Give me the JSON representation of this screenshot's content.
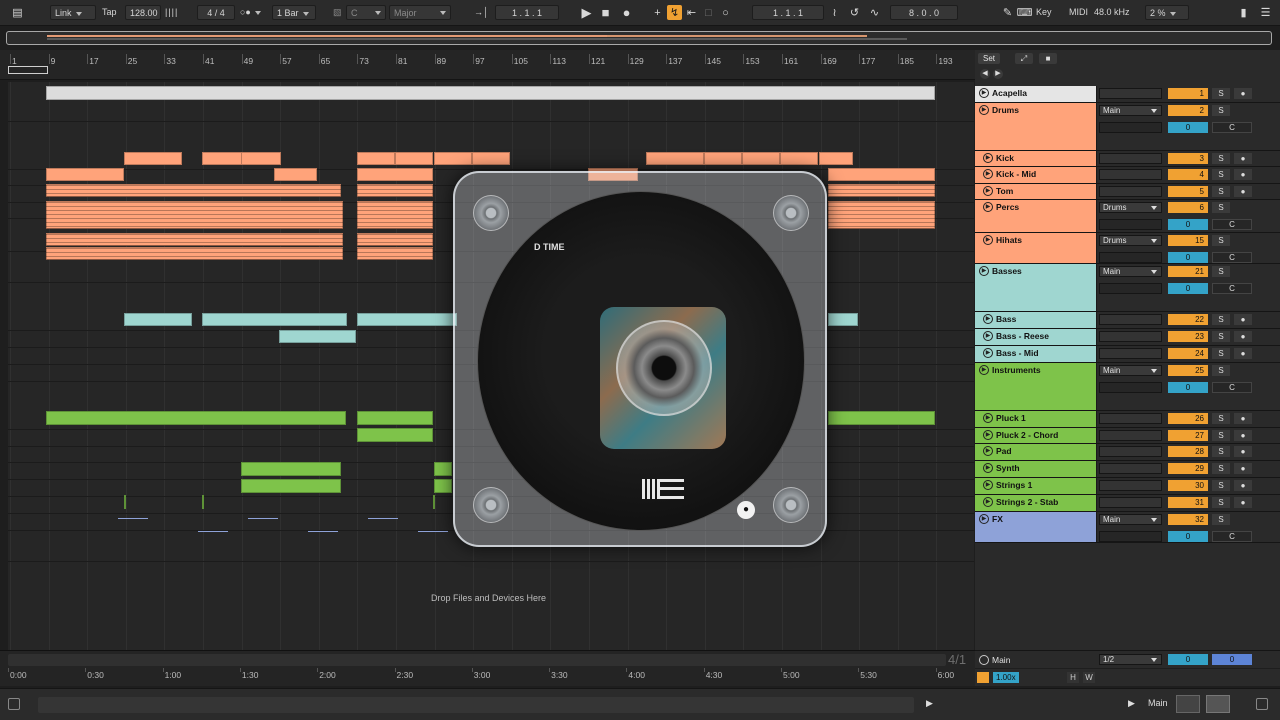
{
  "topbar": {
    "link": "Link",
    "tap": "Tap",
    "tempo": "128.00",
    "time_sig": "4 / 4",
    "quantize": "1 Bar",
    "key_root": "C",
    "scale": "Major",
    "arrangement_position": "1 . 1 . 1",
    "loop_start": "1 . 1 . 1",
    "loop_length": "8 . 0 . 0",
    "key_map": "Key",
    "midi_map": "MIDI",
    "sample_rate": "48.0 kHz",
    "cpu": "2 %"
  },
  "ruler": {
    "bars": [
      "1",
      "9",
      "17",
      "25",
      "33",
      "41",
      "49",
      "57",
      "65",
      "73",
      "81",
      "89",
      "97",
      "105",
      "113",
      "121",
      "129",
      "137",
      "145",
      "153",
      "161",
      "169",
      "177",
      "185",
      "193"
    ]
  },
  "arrangement": {
    "drop_hint": "Drop Files and Devices Here",
    "zoom_fraction": "4/1"
  },
  "timeline": {
    "labels": [
      "0:00",
      "0:30",
      "1:00",
      "1:30",
      "2:00",
      "2:30",
      "3:00",
      "3:30",
      "4:00",
      "4:30",
      "5:00",
      "5:30",
      "6:00"
    ]
  },
  "track_header": {
    "set_label": "Set"
  },
  "tracks": [
    {
      "name": "Acapella",
      "color": "#e5e5e5",
      "group": false,
      "sub": false,
      "route": "",
      "number": "1",
      "solo": "S",
      "rec_icon": "record-icon"
    },
    {
      "name": "Drums",
      "color": "#ffa37a",
      "group": true,
      "sub": false,
      "route": "Main",
      "number": "2",
      "solo": "S",
      "pan": "0",
      "cue": "C"
    },
    {
      "name": "Kick",
      "color": "#ffa37a",
      "group": false,
      "sub": true,
      "route": "",
      "number": "3",
      "solo": "S"
    },
    {
      "name": "Kick - Mid",
      "color": "#ffa37a",
      "group": false,
      "sub": true,
      "route": "",
      "number": "4",
      "solo": "S"
    },
    {
      "name": "Tom",
      "color": "#ffa37a",
      "group": false,
      "sub": true,
      "route": "",
      "number": "5",
      "solo": "S"
    },
    {
      "name": "Percs",
      "color": "#ffa37a",
      "group": true,
      "sub": true,
      "route": "Drums",
      "number": "6",
      "solo": "S",
      "pan": "0",
      "cue": "C"
    },
    {
      "name": "Hihats",
      "color": "#ffa37a",
      "group": true,
      "sub": true,
      "route": "Drums",
      "number": "15",
      "solo": "S",
      "pan": "0",
      "cue": "C"
    },
    {
      "name": "Basses",
      "color": "#9fd6d0",
      "group": true,
      "sub": false,
      "route": "Main",
      "number": "21",
      "solo": "S",
      "pan": "0",
      "cue": "C"
    },
    {
      "name": "Bass",
      "color": "#9fd6d0",
      "group": false,
      "sub": true,
      "route": "",
      "number": "22",
      "solo": "S"
    },
    {
      "name": "Bass - Reese",
      "color": "#9fd6d0",
      "group": false,
      "sub": true,
      "route": "",
      "number": "23",
      "solo": "S"
    },
    {
      "name": "Bass - Mid",
      "color": "#9fd6d0",
      "group": false,
      "sub": true,
      "route": "",
      "number": "24",
      "solo": "S"
    },
    {
      "name": "Instruments",
      "color": "#7ec34a",
      "group": true,
      "sub": false,
      "route": "Main",
      "number": "25",
      "solo": "S",
      "pan": "0",
      "cue": "C"
    },
    {
      "name": "Pluck 1",
      "color": "#7ec34a",
      "group": false,
      "sub": true,
      "route": "",
      "number": "26",
      "solo": "S"
    },
    {
      "name": "Pluck 2 - Chord",
      "color": "#7ec34a",
      "group": false,
      "sub": true,
      "route": "",
      "number": "27",
      "solo": "S"
    },
    {
      "name": "Pad",
      "color": "#7ec34a",
      "group": false,
      "sub": true,
      "route": "",
      "number": "28",
      "solo": "S"
    },
    {
      "name": "Synth",
      "color": "#7ec34a",
      "group": false,
      "sub": true,
      "route": "",
      "number": "29",
      "solo": "S"
    },
    {
      "name": "Strings 1",
      "color": "#7ec34a",
      "group": false,
      "sub": true,
      "route": "",
      "number": "30",
      "solo": "S"
    },
    {
      "name": "Strings 2 - Stab",
      "color": "#7ec34a",
      "group": false,
      "sub": true,
      "route": "",
      "number": "31",
      "solo": "S"
    },
    {
      "name": "FX",
      "color": "#8ea2d8",
      "group": true,
      "sub": false,
      "route": "Main",
      "number": "32",
      "solo": "S",
      "pan": "0",
      "cue": "C"
    }
  ],
  "main_track": {
    "name": "Main",
    "cue_out": "1/2",
    "vol": "0",
    "pan": "0",
    "speed": "1.00x",
    "h": "H",
    "w": "W"
  },
  "status": {
    "output": "Main"
  },
  "overlay": {
    "cd_text": "D TIME"
  },
  "colors": {
    "accent": "#f0a132",
    "drums": "#ffa37a",
    "bass": "#9fd6d0",
    "instruments": "#7ec34a",
    "fx": "#8ea2d8",
    "pan": "#34a3c8"
  }
}
